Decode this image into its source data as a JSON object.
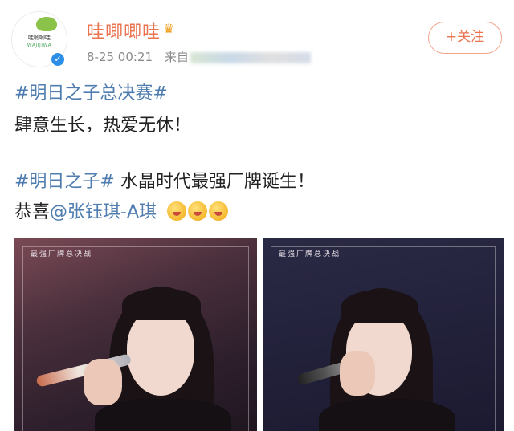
{
  "profile": {
    "avatar_brand": "哇唧唧哇",
    "avatar_sub": "WAJIJIWA",
    "username": "哇唧唧哇",
    "crown_icon": "crown-icon",
    "verify_icon": "verified-check-icon",
    "timestamp": "8-25 00:21",
    "source_prefix": "来自"
  },
  "follow_button": {
    "label": "+关注"
  },
  "post": {
    "line1_tag": "#明日之子总决赛#",
    "line2_text": "肆意生长，热爱无休！",
    "line3_tag": "#明日之子#",
    "line3_text": " 水晶时代最强厂牌诞生！",
    "line4_prefix": "恭喜",
    "line4_mention": "@张钰琪-A琪",
    "emoji_icon": "blowing-kiss-emoji-icon"
  },
  "photos": [
    {
      "caption": "最强厂牌总决战"
    },
    {
      "caption": "最强厂牌总决战"
    }
  ],
  "colors": {
    "accent": "#eb7350",
    "link": "#507daf",
    "meta": "#8a8a8a"
  }
}
